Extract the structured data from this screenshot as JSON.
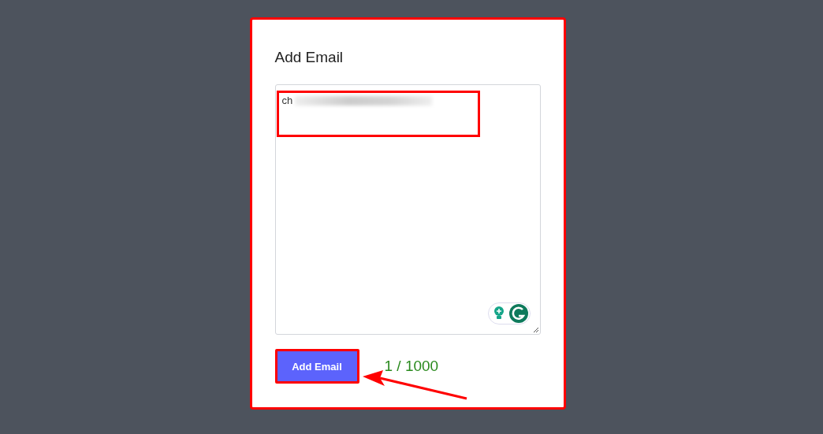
{
  "dialog": {
    "title": "Add Email"
  },
  "email_field": {
    "value": "ch"
  },
  "add_button": {
    "label": "Add Email"
  },
  "counter": "1 / 1000"
}
